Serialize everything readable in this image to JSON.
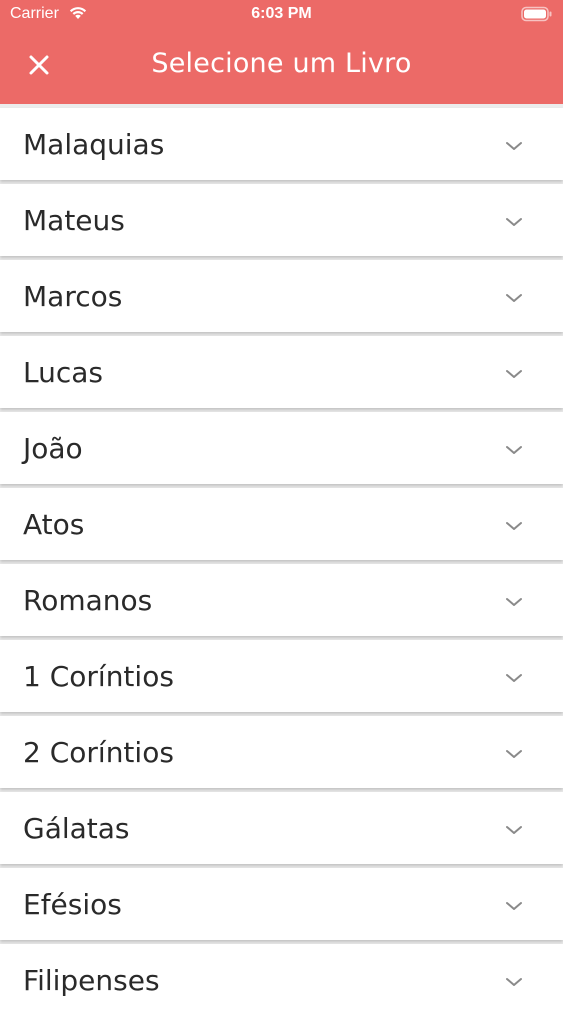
{
  "status_bar": {
    "carrier": "Carrier",
    "time": "6:03 PM"
  },
  "header": {
    "title": "Selecione um Livro",
    "close_icon": "close-icon",
    "background_color": "#ec6a67"
  },
  "books": [
    {
      "label": "Malaquias"
    },
    {
      "label": "Mateus"
    },
    {
      "label": "Marcos"
    },
    {
      "label": "Lucas"
    },
    {
      "label": "João"
    },
    {
      "label": "Atos"
    },
    {
      "label": "Romanos"
    },
    {
      "label": "1 Coríntios"
    },
    {
      "label": "2 Coríntios"
    },
    {
      "label": "Gálatas"
    },
    {
      "label": "Efésios"
    },
    {
      "label": "Filipenses"
    }
  ],
  "item_icon": "chevron-down-icon"
}
